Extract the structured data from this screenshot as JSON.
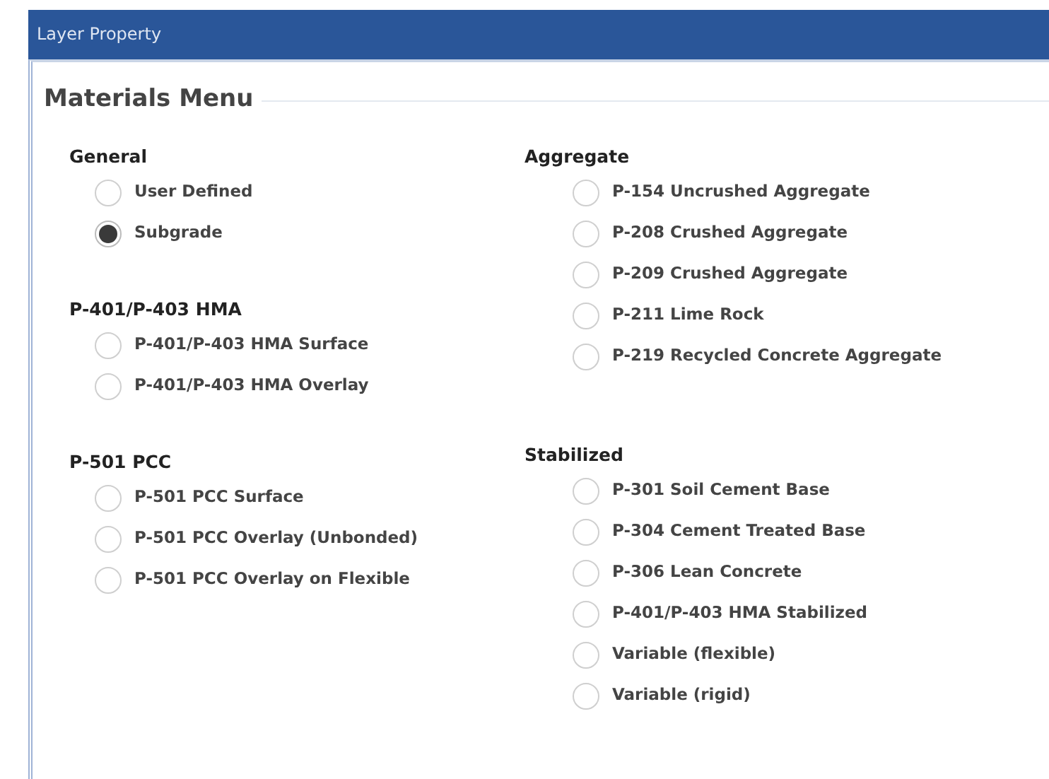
{
  "window": {
    "title": "Layer Property"
  },
  "panel": {
    "title": "Materials Menu"
  },
  "columns": [
    {
      "groups": [
        {
          "heading": "General",
          "options": [
            {
              "label": "User Defined",
              "selected": false
            },
            {
              "label": "Subgrade",
              "selected": true
            }
          ]
        },
        {
          "heading": "P-401/P-403 HMA",
          "options": [
            {
              "label": "P-401/P-403 HMA Surface",
              "selected": false
            },
            {
              "label": "P-401/P-403 HMA Overlay",
              "selected": false
            }
          ]
        },
        {
          "heading": "P-501 PCC",
          "options": [
            {
              "label": "P-501 PCC Surface",
              "selected": false
            },
            {
              "label": "P-501 PCC Overlay (Unbonded)",
              "selected": false
            },
            {
              "label": "P-501 PCC Overlay on Flexible",
              "selected": false
            }
          ]
        }
      ]
    },
    {
      "groups": [
        {
          "heading": "Aggregate",
          "options": [
            {
              "label": "P-154 Uncrushed Aggregate",
              "selected": false
            },
            {
              "label": "P-208 Crushed Aggregate",
              "selected": false
            },
            {
              "label": "P-209 Crushed Aggregate",
              "selected": false
            },
            {
              "label": "P-211 Lime Rock",
              "selected": false
            },
            {
              "label": "P-219 Recycled Concrete Aggregate",
              "selected": false
            }
          ]
        },
        {
          "heading": "Stabilized",
          "options": [
            {
              "label": "P-301 Soil Cement Base",
              "selected": false
            },
            {
              "label": "P-304 Cement Treated Base",
              "selected": false
            },
            {
              "label": "P-306 Lean Concrete",
              "selected": false
            },
            {
              "label": "P-401/P-403 HMA Stabilized",
              "selected": false
            },
            {
              "label": "Variable (flexible)",
              "selected": false
            },
            {
              "label": "Variable (rigid)",
              "selected": false
            }
          ]
        }
      ]
    }
  ]
}
